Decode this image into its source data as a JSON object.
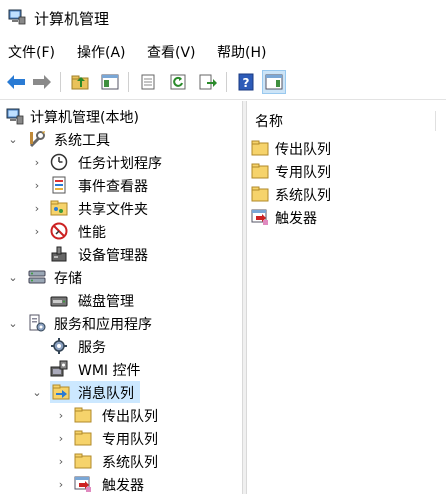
{
  "window": {
    "title": "计算机管理"
  },
  "menu": [
    {
      "label": "文件(F)"
    },
    {
      "label": "操作(A)"
    },
    {
      "label": "查看(V)"
    },
    {
      "label": "帮助(H)"
    }
  ],
  "toolbar": {
    "buttons": [
      "back-icon",
      "forward-icon",
      "up-folder-icon",
      "show-hide-tree-icon",
      "properties-icon",
      "refresh-icon",
      "export-list-icon",
      "help-icon",
      "show-hide-action-pane-icon"
    ]
  },
  "tree": {
    "root": "计算机管理(本地)",
    "system_tools": "系统工具",
    "task_scheduler": "任务计划程序",
    "event_viewer": "事件查看器",
    "shared_folders": "共享文件夹",
    "performance": "性能",
    "device_manager": "设备管理器",
    "storage": "存储",
    "disk_management": "磁盘管理",
    "services_apps": "服务和应用程序",
    "services": "服务",
    "wmi_control": "WMI 控件",
    "message_queuing": "消息队列",
    "outgoing_queues": "传出队列",
    "private_queues": "专用队列",
    "system_queues": "系统队列",
    "triggers": "触发器"
  },
  "list": {
    "column_name": "名称",
    "items": [
      {
        "label": "传出队列",
        "icon": "folder-icon"
      },
      {
        "label": "专用队列",
        "icon": "folder-icon"
      },
      {
        "label": "系统队列",
        "icon": "folder-icon"
      },
      {
        "label": "触发器",
        "icon": "trigger-icon"
      }
    ]
  },
  "colors": {
    "selection": "#cce8ff",
    "folder": "#f6d36b",
    "accent": "#1e6fd9"
  }
}
